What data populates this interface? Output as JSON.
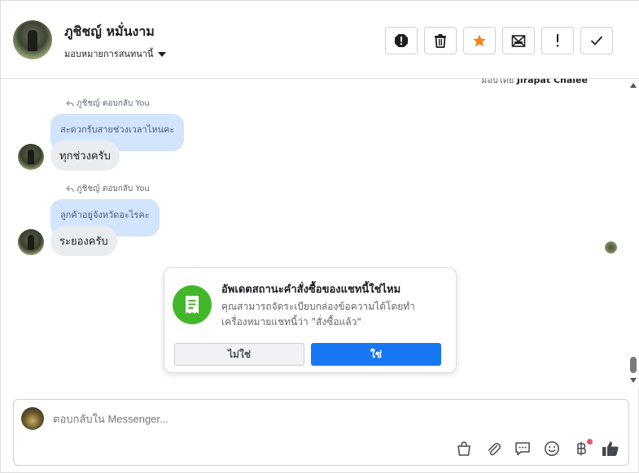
{
  "header": {
    "contact_name": "ภูชิชญ์ หมั่นงาม",
    "assign_label": "มอบหมายการสนทนานี้"
  },
  "messages": {
    "clipped_top_prefix": "มอบโดย",
    "clipped_top_name": "Jirapat Chalee",
    "items": [
      {
        "reply_label": "ภูชิชญ์ ตอบกลับ You",
        "quoted": "สะดวกรับสายช่วงเวลาไหนคะ",
        "text": "ทุกช่วงครับ"
      },
      {
        "reply_label": "ภูชิชญ์ ตอบกลับ You",
        "quoted": "ลูกค้าอยู่จังหวัดอะไรคะ",
        "text": "ระยองครับ"
      }
    ]
  },
  "prompt": {
    "title": "อัพเดตสถานะคำสั่งซื้อของแชทนี้ใช่ไหม",
    "description": "คุณสามารถจัดระเบียบกล่องข้อความได้โดยทำเครื่องหมายแชทนี้ว่า \"สั่งซื้อแล้ว\"",
    "no_label": "ไม่ใช่",
    "yes_label": "ใช่"
  },
  "composer": {
    "placeholder": "ตอบกลับใน Messenger..."
  },
  "colors": {
    "accent": "#1877f2",
    "star": "#f5831f",
    "success": "#42b72a",
    "quote_bg": "#d3e4fd",
    "bubble_bg": "#eaedf0"
  },
  "icons": {
    "header": [
      "alert-circle-icon",
      "trash-icon",
      "star-icon",
      "mark-unread-icon",
      "exclamation-icon",
      "check-icon"
    ],
    "composer": [
      "shopping-bag-icon",
      "paperclip-icon",
      "saved-reply-icon",
      "emoji-icon",
      "baht-icon",
      "thumbs-up-icon"
    ]
  }
}
